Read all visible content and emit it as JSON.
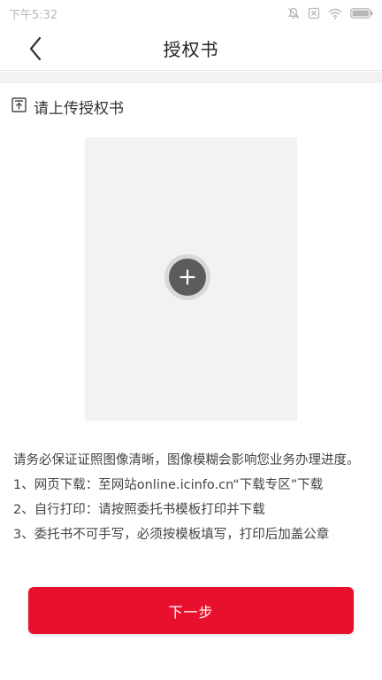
{
  "status_bar": {
    "time": "下午5:32",
    "icons": [
      "dnd-icon",
      "sim-icon",
      "wifi-icon",
      "battery-icon"
    ]
  },
  "nav": {
    "title": "授权书",
    "back_icon": "chevron-left-icon"
  },
  "section": {
    "icon": "upload-icon",
    "title": "请上传授权书"
  },
  "upload": {
    "icon": "plus-icon"
  },
  "instructions": {
    "notice": "请务必保证证照图像清晰，图像模糊会影响您业务办理进度。",
    "step1": "1、网页下载：至网站online.icinfo.cn“下载专区”下载",
    "step2": "2、自行打印：请按照委托书模板打印并下载",
    "step3": "3、委托书不可手写，必须按模板填写，打印后加盖公章"
  },
  "next_button": {
    "label": "下一步"
  },
  "colors": {
    "accent": "#e8112d",
    "upload_bg": "#f2f2f2",
    "plus_bg": "#5c5c5c"
  }
}
